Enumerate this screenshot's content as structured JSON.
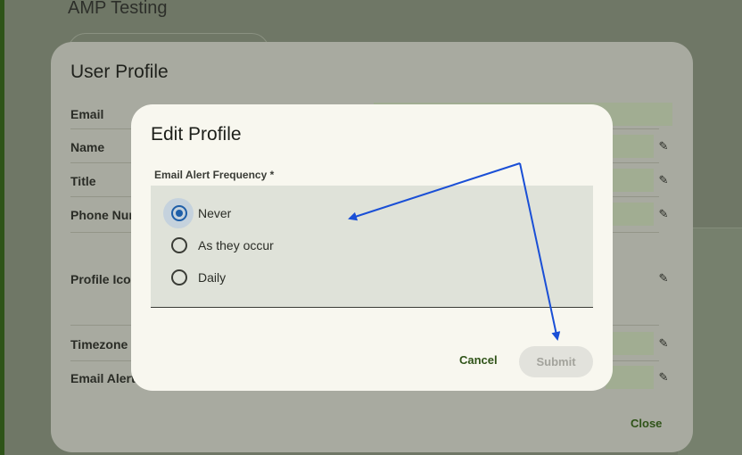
{
  "app": {
    "title": "AMP Testing"
  },
  "profile_dialog": {
    "title": "User Profile",
    "fields": [
      {
        "label": "Email"
      },
      {
        "label": "Name"
      },
      {
        "label": "Title"
      },
      {
        "label": "Phone Nur"
      },
      {
        "label": "Profile Icor"
      },
      {
        "label": "Timezone"
      },
      {
        "label": "Email Alert"
      }
    ],
    "close_label": "Close"
  },
  "edit_dialog": {
    "title": "Edit Profile",
    "field_label": "Email Alert Frequency *",
    "options": [
      {
        "label": "Never",
        "selected": true
      },
      {
        "label": "As they occur",
        "selected": false
      },
      {
        "label": "Daily",
        "selected": false
      }
    ],
    "cancel_label": "Cancel",
    "submit_label": "Submit",
    "submit_enabled": false
  },
  "colors": {
    "accent_green": "#2f5318",
    "radio_selected": "#1f5fa8",
    "annotation_arrow": "#1a4fd6"
  }
}
